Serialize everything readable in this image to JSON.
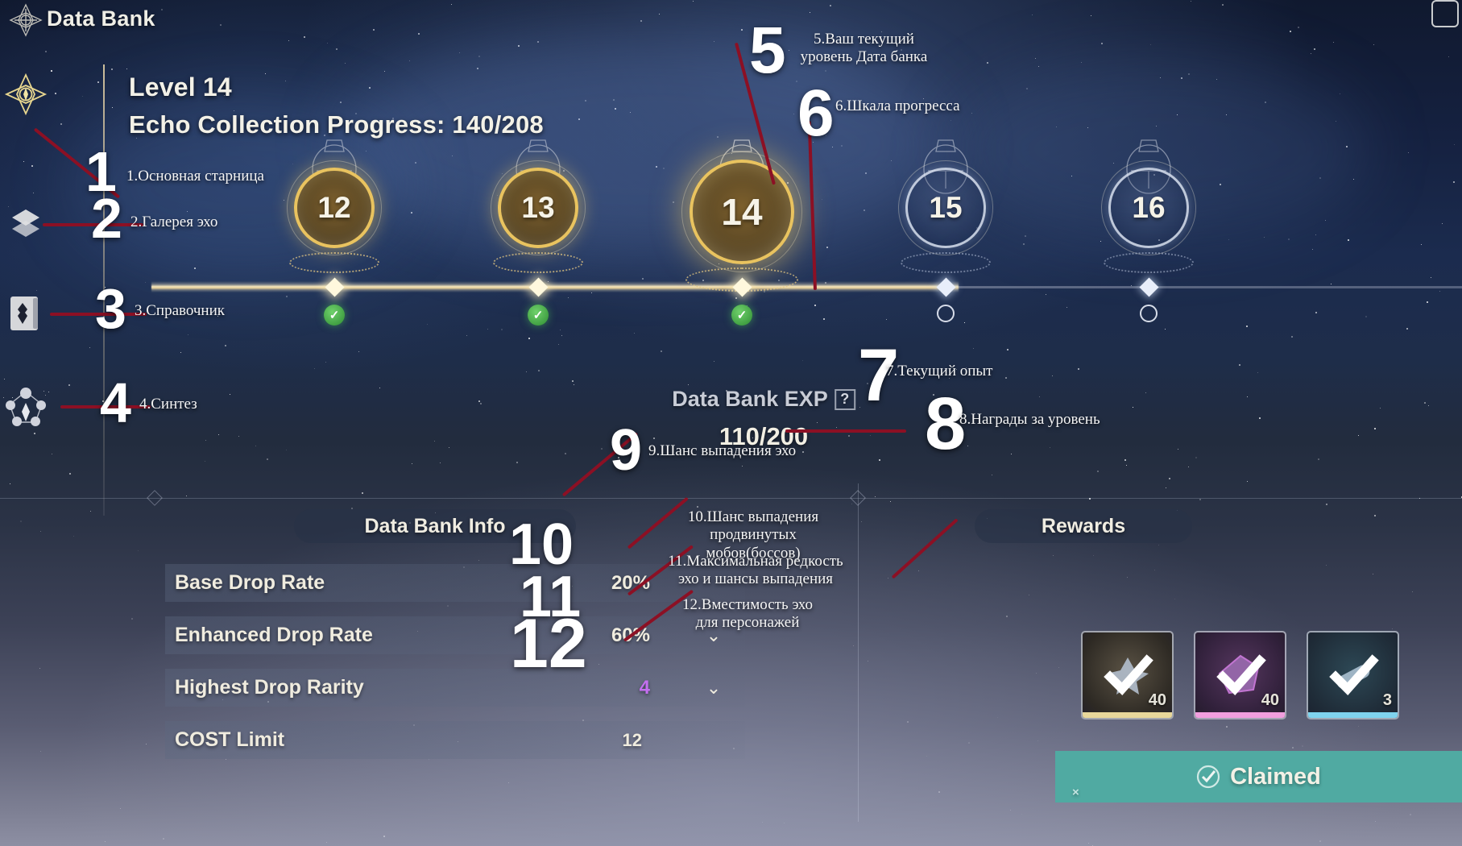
{
  "header": {
    "title": "Data Bank",
    "emblem_icon": "compass-emblem-icon",
    "close_icon": "close-icon"
  },
  "sidebar": {
    "items": [
      {
        "id": "main-page",
        "icon": "compass-emblem-icon"
      },
      {
        "id": "echo-gallery",
        "icon": "layers-icon"
      },
      {
        "id": "handbook",
        "icon": "book-icon"
      },
      {
        "id": "synthesis",
        "icon": "molecule-icon"
      }
    ]
  },
  "level_header": {
    "level_label": "Level 14",
    "progress_label": "Echo Collection Progress: 140/208"
  },
  "timeline": {
    "nodes": [
      {
        "level": "12",
        "state": "done",
        "marker": "check"
      },
      {
        "level": "13",
        "state": "done",
        "marker": "check"
      },
      {
        "level": "14",
        "state": "current",
        "marker": "check"
      },
      {
        "level": "15",
        "state": "locked",
        "marker": "circle"
      },
      {
        "level": "16",
        "state": "locked",
        "marker": "circle"
      }
    ]
  },
  "exp": {
    "title": "Data Bank EXP",
    "help_icon": "question-mark-icon",
    "value": "110/200"
  },
  "info_panel": {
    "title": "Data Bank Info",
    "rows": [
      {
        "label": "Base Drop Rate",
        "value": "20%",
        "value_color": "normal",
        "has_chevron": false
      },
      {
        "label": "Enhanced Drop Rate",
        "value": "60%",
        "value_color": "normal",
        "has_chevron": true
      },
      {
        "label": "Highest Drop Rarity",
        "value": "4",
        "value_color": "purple",
        "has_chevron": true
      },
      {
        "label": "COST Limit",
        "value": "12",
        "value_color": "normal",
        "has_chevron": false
      }
    ]
  },
  "rewards_panel": {
    "title": "Rewards",
    "items": [
      {
        "icon": "shard-star-icon",
        "count": "40",
        "rarity_color": "#e8d79a"
      },
      {
        "icon": "purple-gem-icon",
        "count": "40",
        "rarity_color": "#f19ede"
      },
      {
        "icon": "blue-capsule-icon",
        "count": "3",
        "rarity_color": "#7fd3ee"
      }
    ],
    "claim_button": {
      "label": "Claimed",
      "icon": "check-badge-icon",
      "color": "#50aaa2"
    }
  },
  "annotations": [
    {
      "num": "1",
      "text": "1.Основная старница"
    },
    {
      "num": "2",
      "text": "2.Галерея эхо"
    },
    {
      "num": "3",
      "text": "3.Справочник"
    },
    {
      "num": "4",
      "text": "4.Синтез"
    },
    {
      "num": "5",
      "text": "5.Ваш текущий\nуровень Дата банка"
    },
    {
      "num": "6",
      "text": "6.Шкала прогресса"
    },
    {
      "num": "7",
      "text": "7.Текущий опыт"
    },
    {
      "num": "8",
      "text": "8.Награды за уровень"
    },
    {
      "num": "9",
      "text": "9.Шанс выпадения эхо"
    },
    {
      "num": "10",
      "text": "10.Шанс выпадения\nпродвинутых мобов(боссов)"
    },
    {
      "num": "11",
      "text": "11.Максимальная редкость\nэхо и шансы выпадения"
    },
    {
      "num": "12",
      "text": "12.Вместимость эхо\nдля персонажей"
    }
  ],
  "colors": {
    "annotation_line": "#8c1024",
    "annotation_number": "#ffffff",
    "gold": "#e9c35f",
    "claimed_teal": "#50aaa2",
    "rarity_purple": "#c46ff0"
  }
}
